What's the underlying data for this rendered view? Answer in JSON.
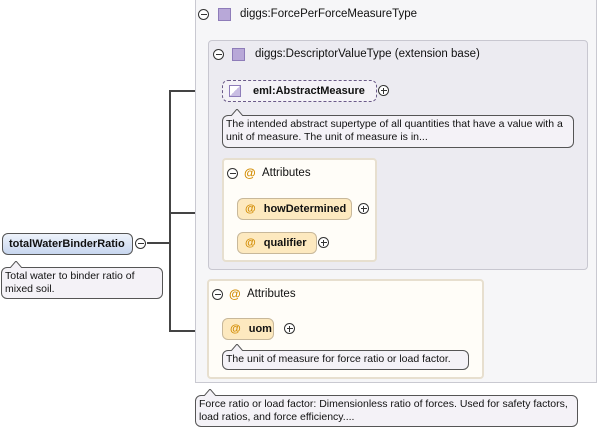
{
  "outer_type": {
    "label": "diggs:ForcePerForceMeasureType"
  },
  "base_type": {
    "label": "diggs:DescriptorValueType (extension base)"
  },
  "abstract_measure": {
    "label": "eml:AbstractMeasure",
    "doc": "The intended abstract supertype of all quantities that have a value with a unit of measure. The unit of measure is in..."
  },
  "inner_attributes": {
    "title": "Attributes",
    "items": [
      {
        "label": "howDetermined"
      },
      {
        "label": "qualifier"
      }
    ]
  },
  "outer_attributes": {
    "title": "Attributes",
    "uom": {
      "label": "uom",
      "doc": "The unit of measure for force ratio or load factor."
    }
  },
  "root_element": {
    "label": "totalWaterBinderRatio",
    "doc": "Total water to binder ratio of mixed soil."
  },
  "type_doc": "Force ratio or load factor: Dimensionless ratio of forces. Used for safety factors, load ratios, and force efficiency....",
  "attribute_symbol": "@"
}
